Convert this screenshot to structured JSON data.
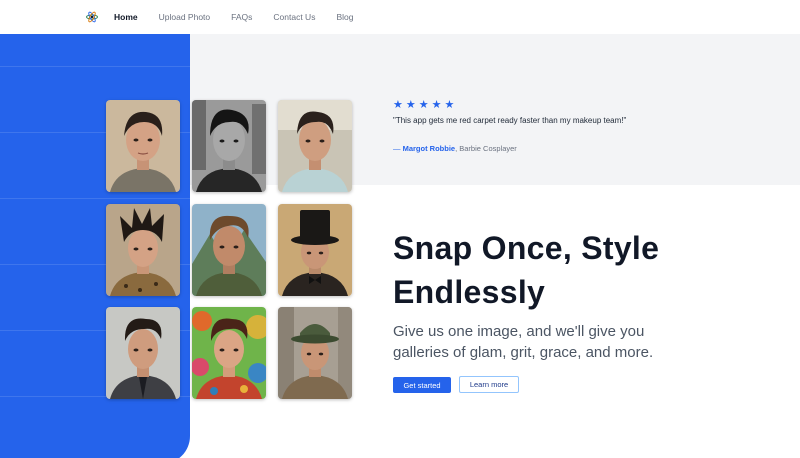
{
  "nav": {
    "logo_icon": "atom-logo-icon",
    "items": [
      {
        "label": "Home",
        "active": true
      },
      {
        "label": "Upload Photo",
        "active": false
      },
      {
        "label": "FAQs",
        "active": false
      },
      {
        "label": "Contact Us",
        "active": false
      },
      {
        "label": "Blog",
        "active": false
      }
    ]
  },
  "testimonial": {
    "rating": 5,
    "stars": "★★★★★",
    "quote": "\"This app gets me red carpet ready faster than my makeup team!\"",
    "dash": "—",
    "author": "Margot Robbie",
    "role": ", Barbie Cosplayer"
  },
  "hero": {
    "headline_line1": "Snap Once, Style",
    "headline_line2": "Endlessly",
    "subtitle": "Give us one image, and we'll give you galleries of glam, grit, grace, and more.",
    "cta_primary": "Get started",
    "cta_secondary": "Learn more"
  },
  "gallery": {
    "styles": [
      "original-portrait",
      "black-and-white-city",
      "office-casual",
      "spiky-hair-leopard",
      "mountain-outdoors",
      "top-hat-vintage",
      "suit-and-tie",
      "colorful-psychedelic",
      "fedora-street"
    ]
  },
  "colors": {
    "accent": "#2563eb",
    "panel_gray": "#f3f4f6",
    "heading": "#111827",
    "body_text": "#4b5563"
  }
}
